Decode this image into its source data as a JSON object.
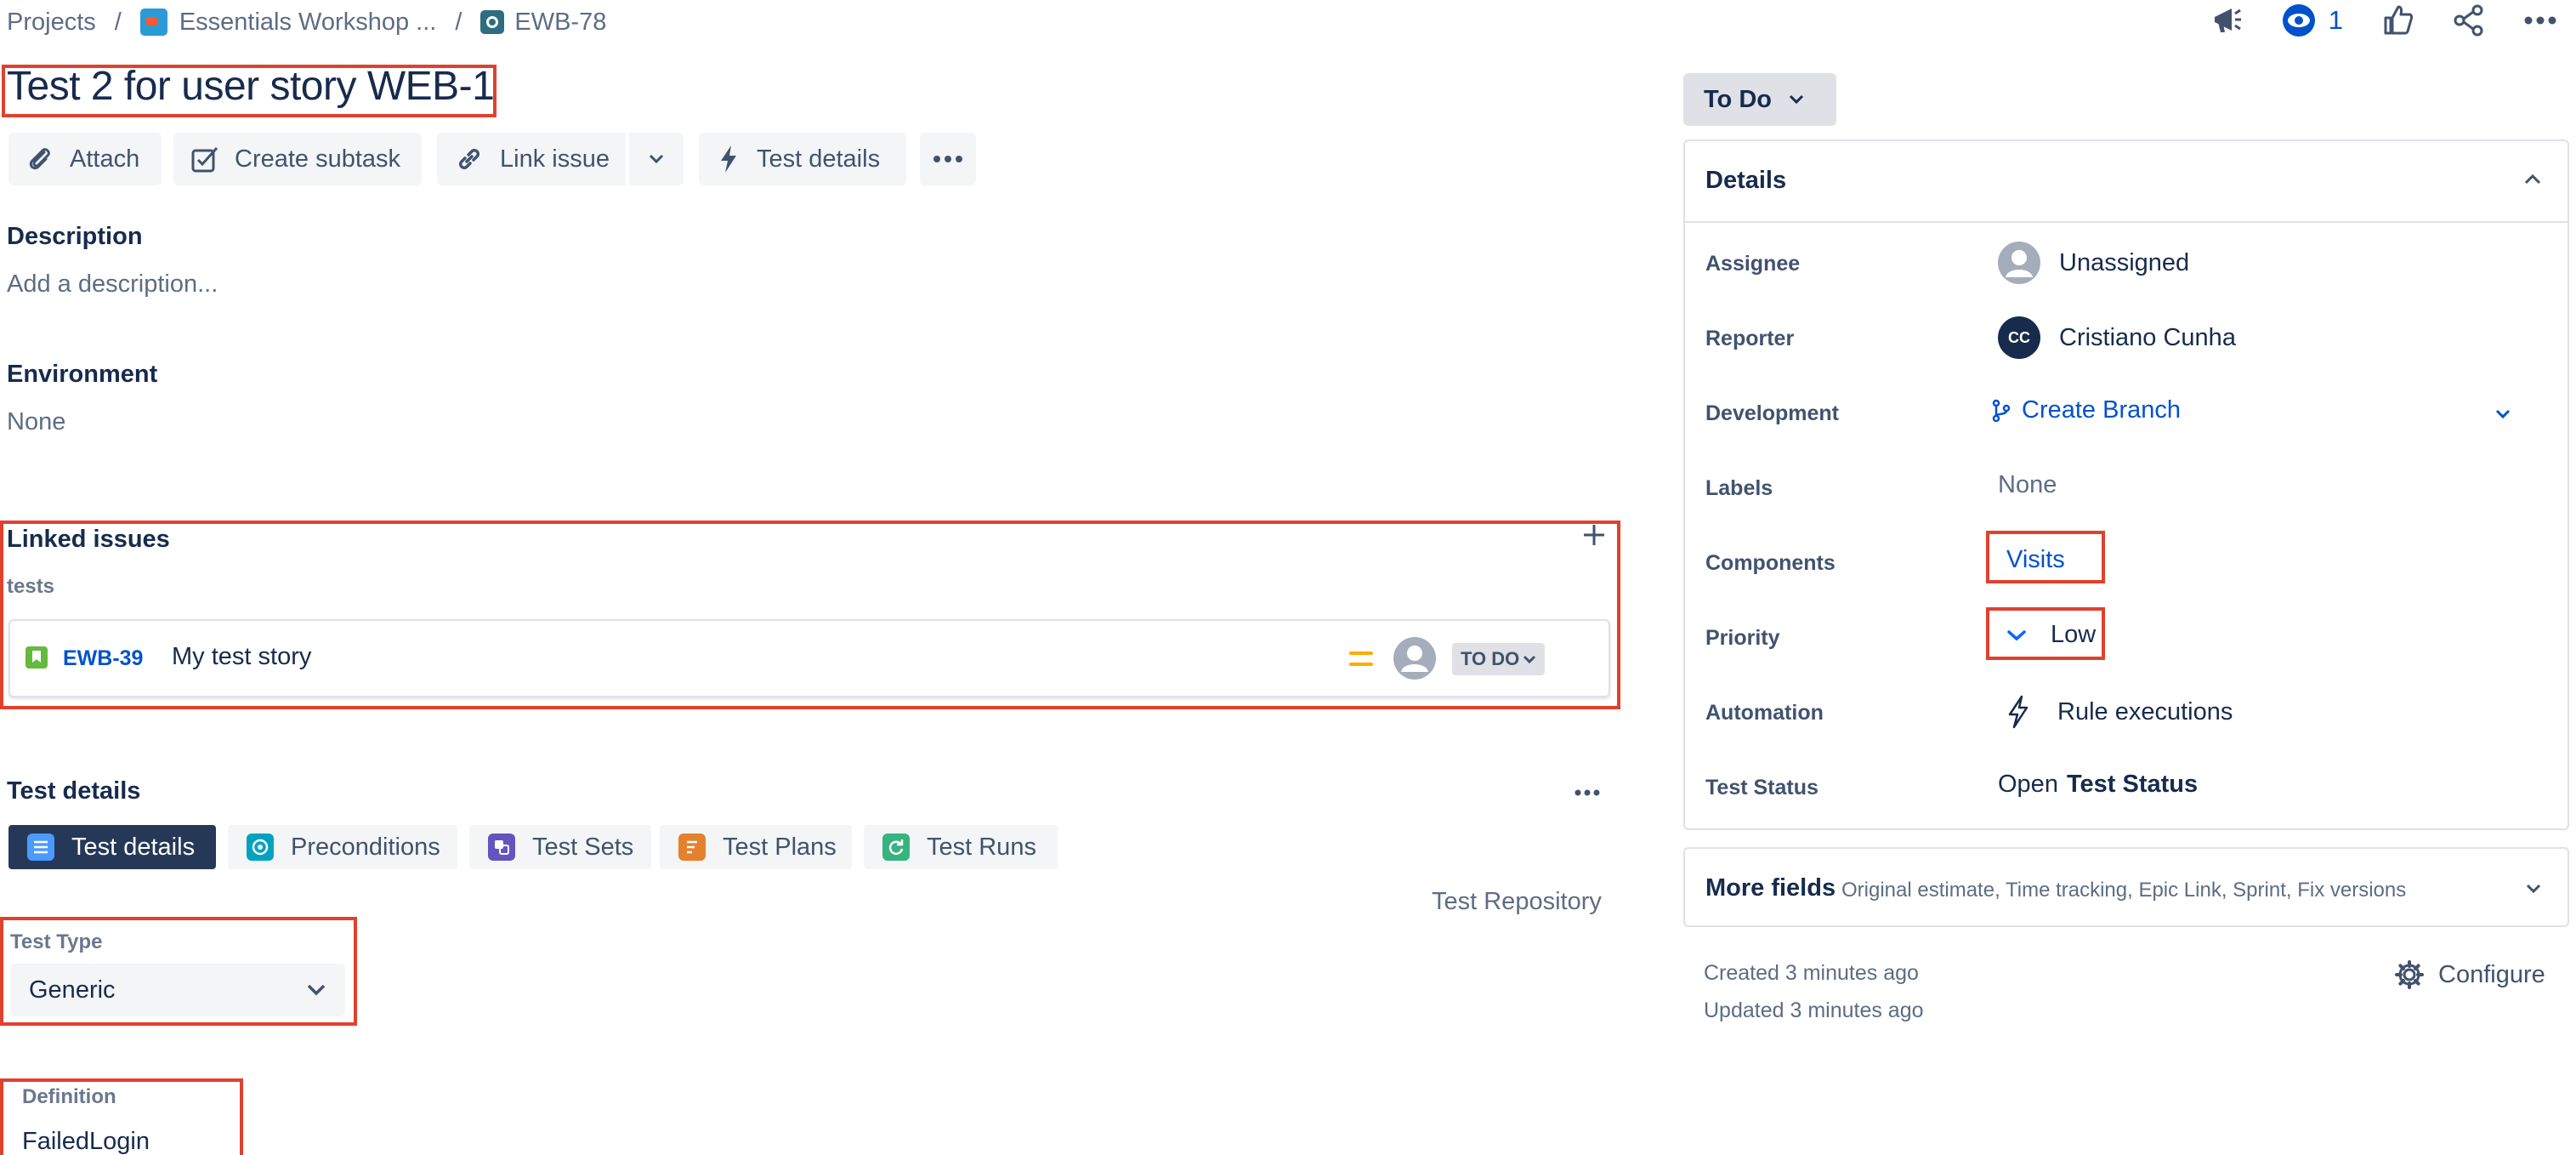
{
  "breadcrumb": {
    "projects": "Projects",
    "separator": "/",
    "project_name": "Essentials Workshop ...",
    "issue_key": "EWB-78"
  },
  "header": {
    "watch_count": "1",
    "icons": [
      "feedback-icon",
      "watch-icon",
      "like-icon",
      "share-icon",
      "more-icon"
    ]
  },
  "issue": {
    "title": "Test 2 for user story WEB-1"
  },
  "toolbar": {
    "attach": "Attach",
    "create_subtask": "Create subtask",
    "link_issue": "Link issue",
    "test_details": "Test details"
  },
  "description": {
    "heading": "Description",
    "placeholder": "Add a description..."
  },
  "environment": {
    "heading": "Environment",
    "value": "None"
  },
  "linked_issues": {
    "heading": "Linked issues",
    "relation": "tests",
    "items": [
      {
        "key": "EWB-39",
        "summary": "My test story",
        "status": "TO DO",
        "priority": "Medium"
      }
    ]
  },
  "test_details": {
    "heading": "Test details",
    "tabs": [
      {
        "label": "Test details",
        "color": "#4c9aff"
      },
      {
        "label": "Preconditions",
        "color": "#00a3bf"
      },
      {
        "label": "Test Sets",
        "color": "#6554c0"
      },
      {
        "label": "Test Plans",
        "color": "#e5812c"
      },
      {
        "label": "Test Runs",
        "color": "#36b37e"
      }
    ],
    "repository_link": "Test Repository",
    "test_type_label": "Test Type",
    "test_type_value": "Generic",
    "definition_label": "Definition",
    "definition_value": "FailedLogin"
  },
  "sidebar": {
    "status": "To Do",
    "details_heading": "Details",
    "fields": {
      "assignee_label": "Assignee",
      "assignee_value": "Unassigned",
      "reporter_label": "Reporter",
      "reporter_initials": "CC",
      "reporter_value": "Cristiano Cunha",
      "development_label": "Development",
      "development_value": "Create Branch",
      "labels_label": "Labels",
      "labels_value": "None",
      "components_label": "Components",
      "components_value": "Visits",
      "priority_label": "Priority",
      "priority_value": "Low",
      "automation_label": "Automation",
      "automation_value": "Rule executions",
      "test_status_label": "Test Status",
      "test_status_value_1": "Open",
      "test_status_value_2": "Test Status"
    },
    "more_fields_heading": "More fields",
    "more_fields_list": "Original estimate, Time tracking, Epic Link, Sprint, Fix versions",
    "created": "Created 3 minutes ago",
    "updated": "Updated 3 minutes ago",
    "configure": "Configure"
  },
  "colors": {
    "brand_blue": "#0052cc",
    "highlight_red": "#e0412d",
    "tab_active": "#253858",
    "priority_medium": "#ffab00",
    "priority_low": "#0065ff"
  }
}
